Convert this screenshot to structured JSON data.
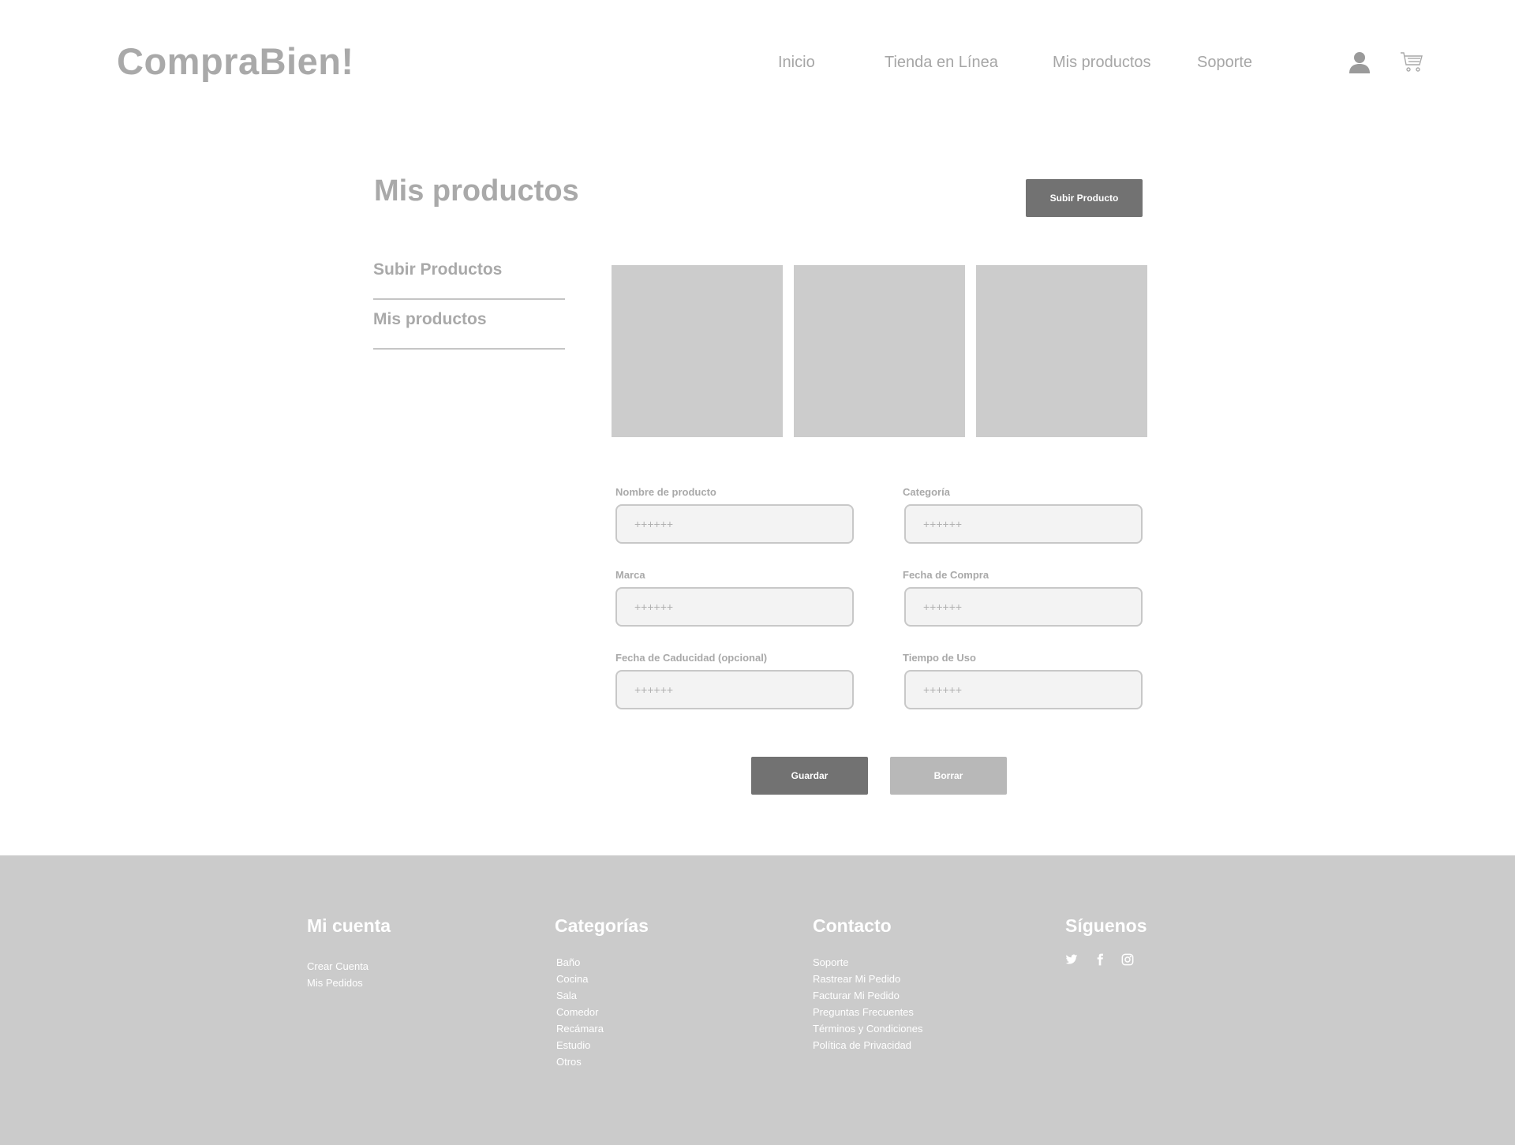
{
  "brand": {
    "logo_text": "CompraBien!"
  },
  "nav": {
    "items": [
      {
        "label": "Inicio"
      },
      {
        "label": "Tienda en Línea"
      },
      {
        "label": "Mis productos"
      },
      {
        "label": "Soporte"
      }
    ],
    "user_icon": "user-icon",
    "cart_icon": "cart-icon"
  },
  "page": {
    "title": "Mis productos",
    "upload_button_label": "Subir Producto"
  },
  "side_menu": {
    "items": [
      {
        "label": "Subir Productos"
      },
      {
        "label": "Mis productos"
      }
    ]
  },
  "form": {
    "fields": [
      {
        "label": "Nombre de producto",
        "placeholder": "++++++"
      },
      {
        "label": "Categoría",
        "placeholder": "++++++"
      },
      {
        "label": "Marca",
        "placeholder": "++++++"
      },
      {
        "label": "Fecha de Compra",
        "placeholder": "++++++"
      },
      {
        "label": "Fecha de Caducidad (opcional)",
        "placeholder": "++++++"
      },
      {
        "label": "Tiempo de Uso",
        "placeholder": "++++++"
      }
    ],
    "save_label": "Guardar",
    "delete_label": "Borrar"
  },
  "footer": {
    "account": {
      "title": "Mi cuenta",
      "links": [
        "Crear Cuenta",
        "Mis Pedidos"
      ]
    },
    "categories": {
      "title": "Categorías",
      "links": [
        "Baño",
        "Cocina",
        "Sala",
        "Comedor",
        "Recámara",
        "Estudio",
        "Otros"
      ]
    },
    "contact": {
      "title": "Contacto",
      "links": [
        "Soporte",
        "Rastrear Mi Pedido",
        "Facturar Mi Pedido",
        "Preguntas Frecuentes",
        "Términos y Condiciones",
        "Política de Privacidad"
      ]
    },
    "follow": {
      "title": "Síguenos",
      "icons": [
        "twitter-icon",
        "facebook-icon",
        "instagram-icon"
      ]
    }
  },
  "colors": {
    "primary_button": "#727272",
    "secondary_button": "#b8b8b8",
    "footer_bg": "#cbcbcb",
    "placeholder_box": "#cccccc"
  }
}
